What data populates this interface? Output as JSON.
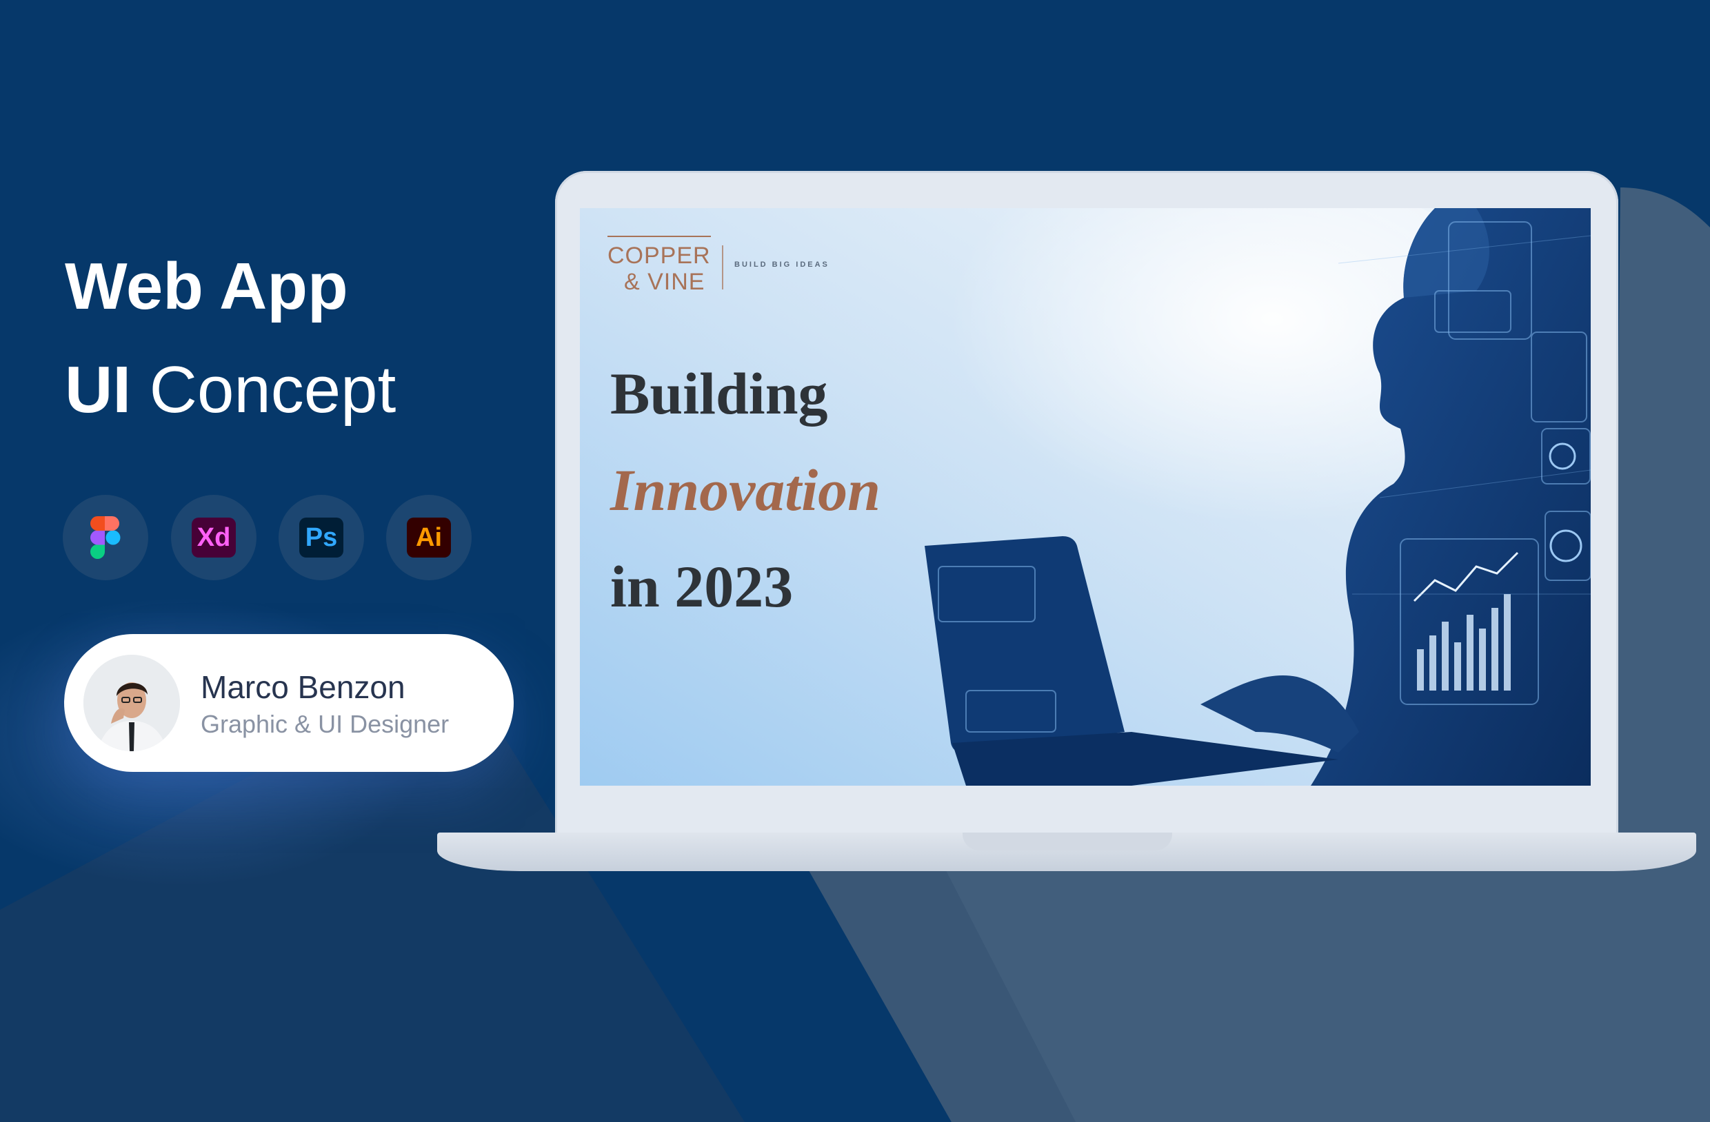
{
  "heading": {
    "line1": "Web App",
    "line2_bold": "UI",
    "line2_light": "Concept"
  },
  "tools": [
    {
      "name": "Figma",
      "label": "",
      "icon": "figma-icon"
    },
    {
      "name": "Adobe XD",
      "label": "Xd",
      "icon": "xd-icon",
      "fg": "#ff61f6",
      "bg": "#470137"
    },
    {
      "name": "Photoshop",
      "label": "Ps",
      "icon": "ps-icon",
      "fg": "#31a8ff",
      "bg": "#001e36"
    },
    {
      "name": "Illustrator",
      "label": "Ai",
      "icon": "ai-icon",
      "fg": "#ff9a00",
      "bg": "#330000"
    }
  ],
  "profile": {
    "name": "Marco Benzon",
    "role": "Graphic & UI Designer"
  },
  "screen": {
    "brand": {
      "copper": "COPPER",
      "vine": "& VINE",
      "tagline": "BUILD BIG IDEAS"
    },
    "hero": {
      "line1": "Building",
      "line2": "Innovation",
      "line3": "in 2023"
    }
  },
  "colors": {
    "background": "#06386a",
    "accent_copper": "#a3684c",
    "card": "#ffffff"
  }
}
